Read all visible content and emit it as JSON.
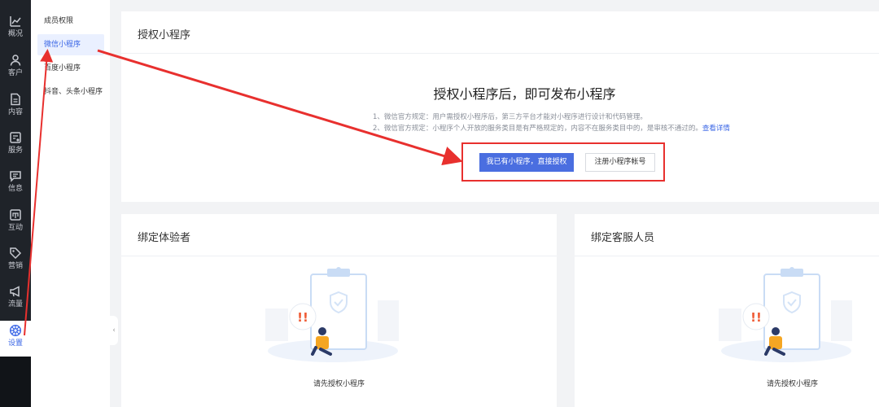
{
  "rail": {
    "items": [
      {
        "label": "概况",
        "icon": "trend-icon"
      },
      {
        "label": "客户",
        "icon": "user-icon"
      },
      {
        "label": "内容",
        "icon": "document-icon"
      },
      {
        "label": "服务",
        "icon": "service-icon"
      },
      {
        "label": "信息",
        "icon": "message-icon"
      },
      {
        "label": "互动",
        "icon": "interaction-icon"
      },
      {
        "label": "营销",
        "icon": "tag-icon"
      },
      {
        "label": "流量",
        "icon": "megaphone-icon"
      },
      {
        "label": "设置",
        "icon": "settings-icon",
        "active": true
      }
    ]
  },
  "submenu": {
    "items": [
      {
        "label": "成员权限"
      },
      {
        "label": "微信小程序",
        "active": true
      },
      {
        "label": "百度小程序"
      },
      {
        "label": "抖音、头条小程序"
      }
    ]
  },
  "auth": {
    "title": "授权小程序",
    "headline": "授权小程序后，即可发布小程序",
    "note1": "1、微信官方规定：用户需授权小程序后，第三方平台才能对小程序进行设计和代码管理。",
    "note2": "2、微信官方规定：小程序个人开放的服务类目是有严格规定的，内容不在服务类目中的，是审核不通过的。",
    "note2_link": "查看详情",
    "primary_button": "我已有小程序，直接授权",
    "secondary_button": "注册小程序帐号"
  },
  "tester": {
    "title": "绑定体验者",
    "empty_text": "请先授权小程序"
  },
  "service": {
    "title": "绑定客服人员",
    "empty_text": "请先授权小程序"
  },
  "colors": {
    "rail_bg": "#1f2329",
    "accent": "#3a66e6",
    "primary_button": "#4a6ee0",
    "annotation_red": "#e8302e"
  }
}
